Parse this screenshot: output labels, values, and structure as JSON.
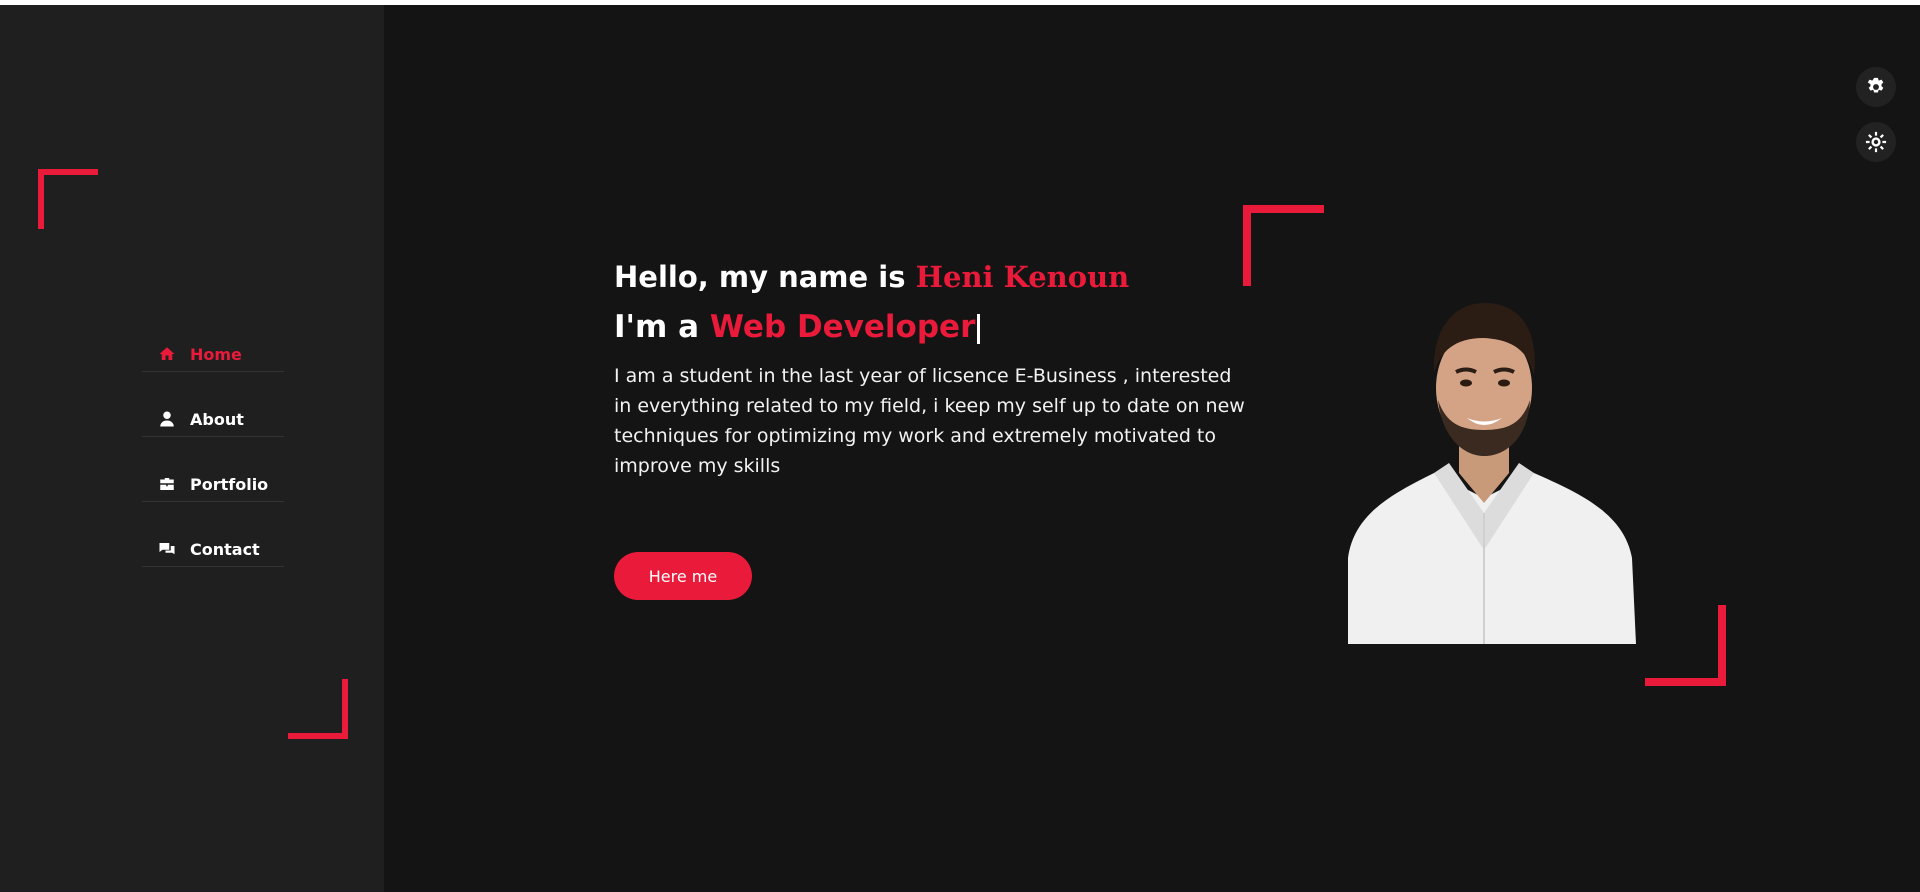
{
  "sidebar": {
    "nav": [
      {
        "label": "Home",
        "icon": "home-icon"
      },
      {
        "label": "About",
        "icon": "user-icon"
      },
      {
        "label": "Portfolio",
        "icon": "briefcase-icon"
      },
      {
        "label": "Contact",
        "icon": "comments-icon"
      }
    ]
  },
  "settings": {
    "icons": [
      "gear-icon",
      "sun-icon"
    ]
  },
  "hero": {
    "greeting": "Hello, my name is",
    "name": "Heni Kenoun",
    "role_prefix": "I'm a",
    "role": "Web Developer",
    "bio": "I am a student in the last year of licsence E-Business , interested in everything related to my field, i keep my self up to date on new techniques for optimizing my work and extremely motivated to improve my skills",
    "button_label": "Here me"
  },
  "colors": {
    "accent": "#e91a3a",
    "background": "#141414",
    "sidebar": "#1f1f1f",
    "text": "#ffffff"
  }
}
